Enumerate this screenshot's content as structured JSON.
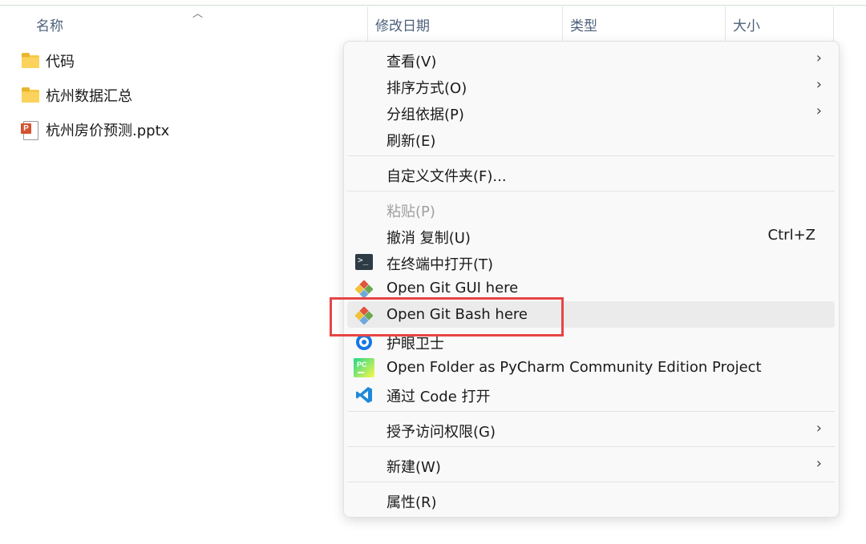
{
  "columns": {
    "name": "名称",
    "modified": "修改日期",
    "type": "类型",
    "size": "大小"
  },
  "files": [
    {
      "name": "代码",
      "icon": "folder-icon"
    },
    {
      "name": "杭州数据汇总",
      "icon": "folder-icon"
    },
    {
      "name": "杭州房价预测.pptx",
      "icon": "powerpoint-file-icon",
      "badge": "P"
    }
  ],
  "context_menu": {
    "view": "查看(V)",
    "sort_by": "排序方式(O)",
    "group_by": "分组依据(P)",
    "refresh": "刷新(E)",
    "customize_folder": "自定义文件夹(F)...",
    "paste": "粘贴(P)",
    "undo_copy": "撤消 复制(U)",
    "undo_copy_shortcut": "Ctrl+Z",
    "open_in_terminal": "在终端中打开(T)",
    "open_git_gui": "Open Git GUI here",
    "open_git_bash": "Open Git Bash here",
    "eye_guard": "护眼卫士",
    "open_pycharm": "Open Folder as PyCharm Community Edition Project",
    "pycharm_badge": "PC",
    "open_vscode": "通过 Code 打开",
    "give_access": "授予访问权限(G)",
    "new": "新建(W)",
    "properties": "属性(R)"
  },
  "colors": {
    "highlight_border": "#e64545",
    "hover_background": "#ebebeb",
    "menu_background": "#f9f9f9"
  }
}
